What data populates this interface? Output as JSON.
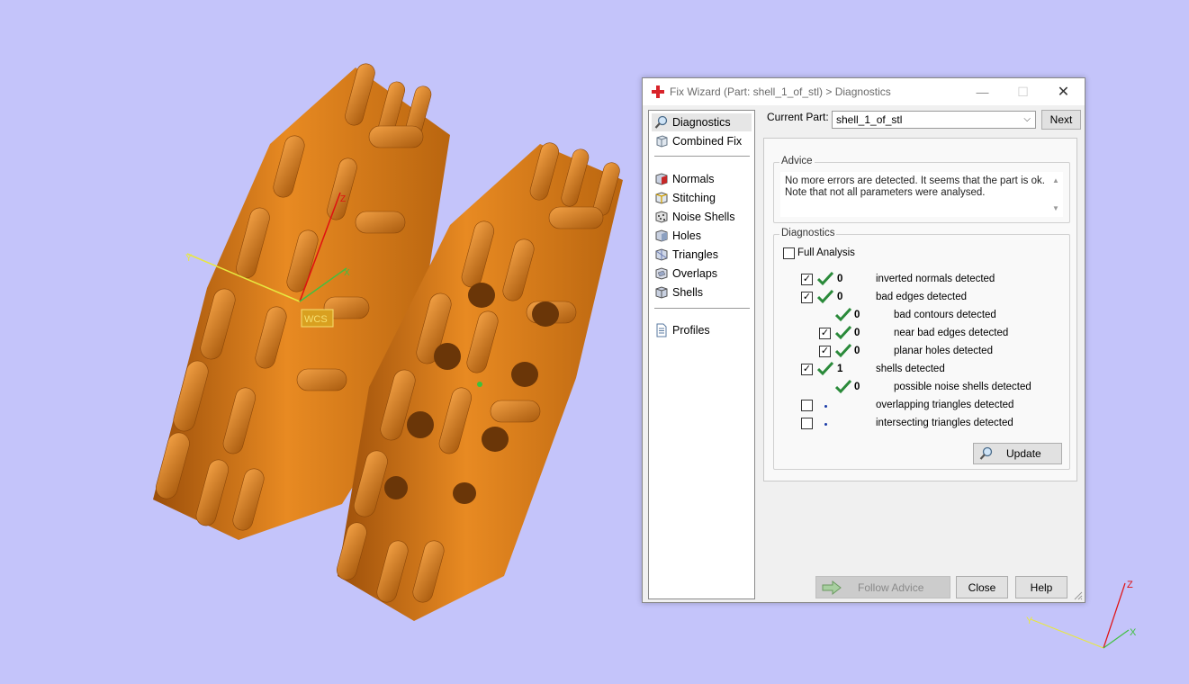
{
  "viewport": {
    "wcs_label": "WCS",
    "axis_labels": {
      "x": "X",
      "y": "Y",
      "z": "Z"
    },
    "model_color": "#d97a18",
    "background": "#c4c4fa"
  },
  "dialog": {
    "title": "Fix Wizard (Part: shell_1_of_stl) > Diagnostics",
    "sidebar": {
      "top_items": [
        {
          "label": "Diagnostics",
          "icon": "magnifier-icon",
          "selected": true
        },
        {
          "label": "Combined Fix",
          "icon": "combined-fix-icon"
        }
      ],
      "fix_items": [
        {
          "label": "Normals",
          "icon": "normals-cube-icon"
        },
        {
          "label": "Stitching",
          "icon": "stitching-cube-icon"
        },
        {
          "label": "Noise Shells",
          "icon": "noise-shells-icon"
        },
        {
          "label": "Holes",
          "icon": "holes-cube-icon"
        },
        {
          "label": "Triangles",
          "icon": "triangles-cube-icon"
        },
        {
          "label": "Overlaps",
          "icon": "overlaps-cube-icon"
        },
        {
          "label": "Shells",
          "icon": "shells-cube-icon"
        }
      ],
      "bottom_items": [
        {
          "label": "Profiles",
          "icon": "document-icon"
        }
      ]
    },
    "current_part_label": "Current Part:",
    "current_part_value": "shell_1_of_stl",
    "next_label": "Next",
    "advice": {
      "group_label": "Advice",
      "text_line1": "No more errors are detected. It seems that the part is ok.",
      "text_line2": "Note that not all parameters were analysed."
    },
    "diagnostics": {
      "group_label": "Diagnostics",
      "full_analysis_label": "Full Analysis",
      "full_analysis_checked": false,
      "rows": [
        {
          "count": "0",
          "label": "inverted normals detected",
          "checked": true,
          "status": "ok"
        },
        {
          "count": "0",
          "label": "bad edges detected",
          "checked": true,
          "status": "ok"
        },
        {
          "count": "0",
          "label": "bad contours detected",
          "status": "ok"
        },
        {
          "count": "0",
          "label": "near bad edges detected",
          "checked": true,
          "status": "ok"
        },
        {
          "count": "0",
          "label": "planar holes detected",
          "checked": true,
          "status": "ok"
        },
        {
          "count": "1",
          "label": "shells detected",
          "checked": true,
          "status": "ok"
        },
        {
          "count": "0",
          "label": "possible noise shells detected",
          "status": "ok"
        },
        {
          "count": "",
          "label": "overlapping triangles detected",
          "checked": false,
          "status": "not-analysed"
        },
        {
          "count": "",
          "label": "intersecting triangles detected",
          "checked": false,
          "status": "not-analysed"
        }
      ],
      "update_label": "Update"
    },
    "buttons": {
      "follow_advice": "Follow Advice",
      "close": "Close",
      "help": "Help"
    }
  }
}
